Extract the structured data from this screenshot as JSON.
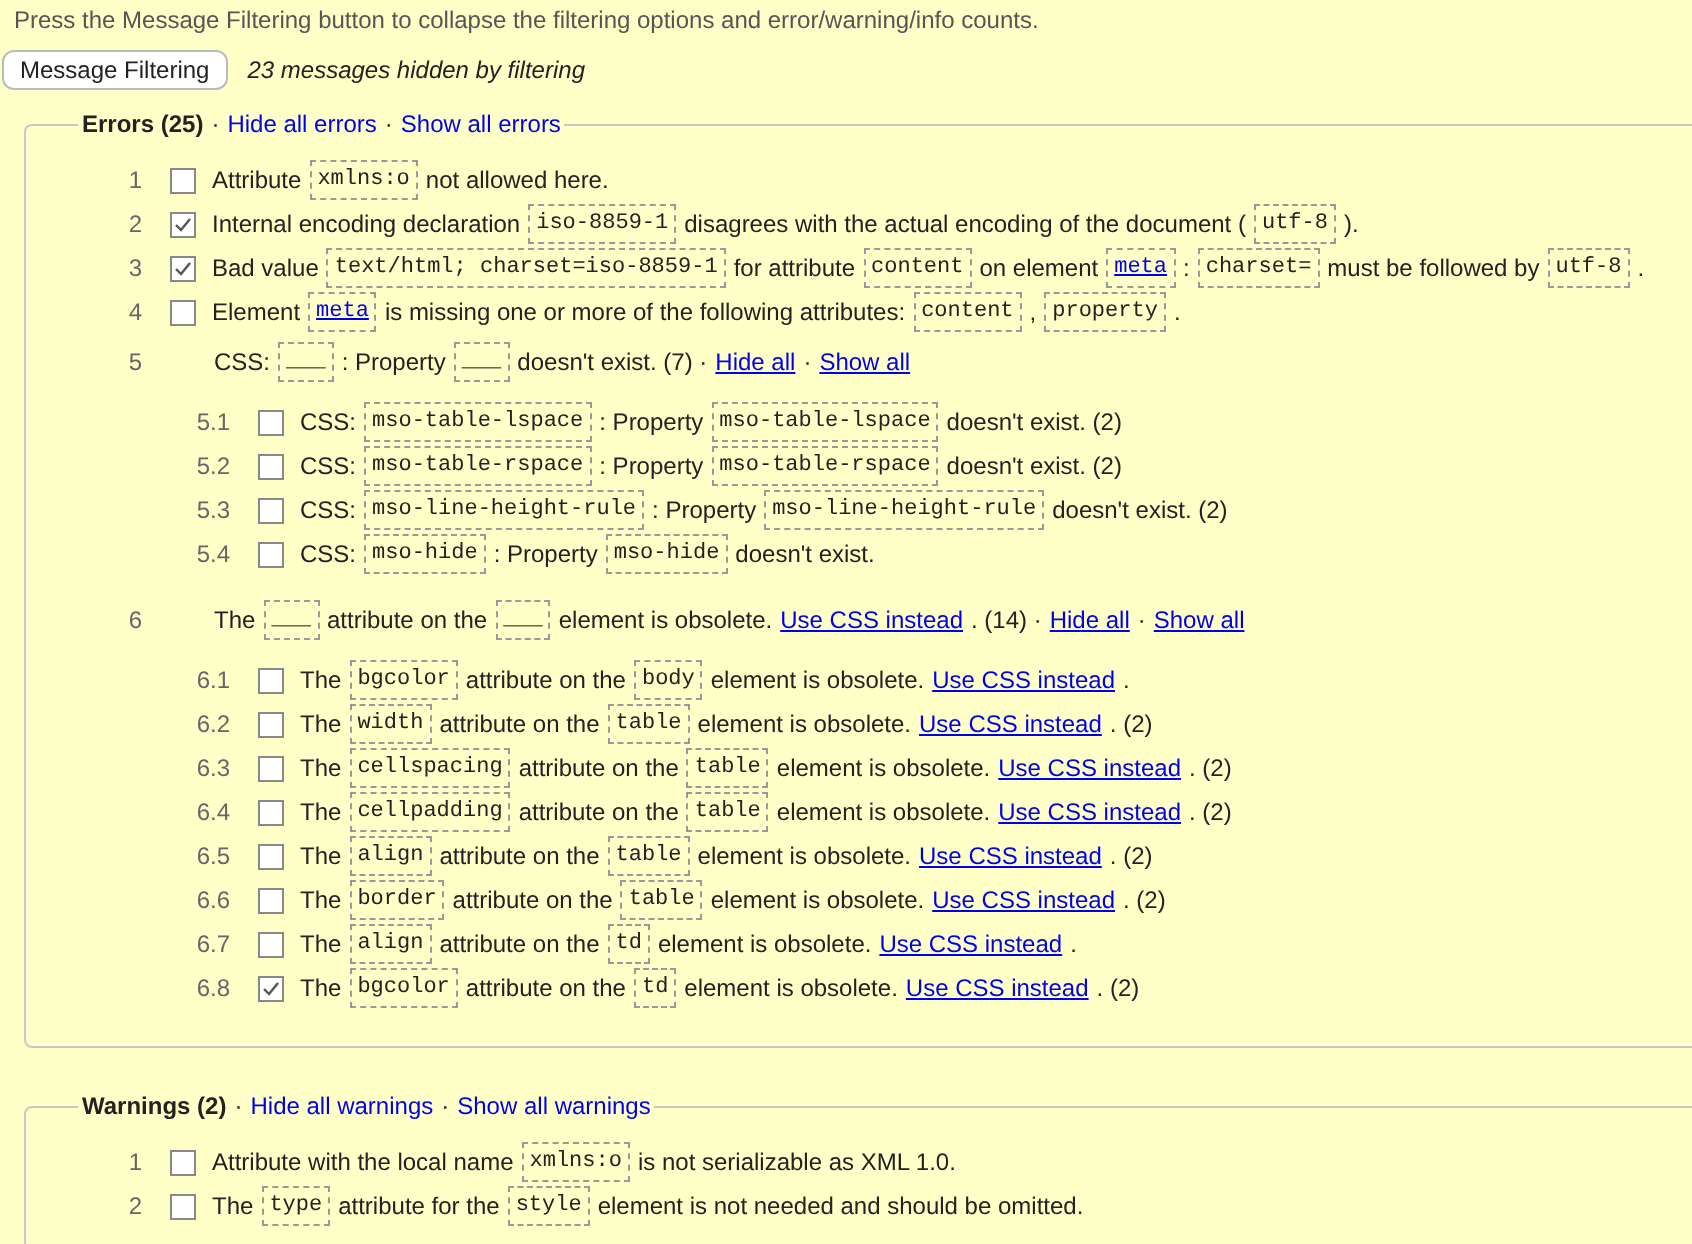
{
  "hint": "Press the Message Filtering button to collapse the filtering options and error/warning/info counts.",
  "filter_button": "Message Filtering",
  "hidden_note": "23 messages hidden by filtering",
  "sections": [
    {
      "legend": [
        {
          "kind": "title",
          "text": "Errors (25)"
        },
        {
          "kind": "text",
          "text": "·"
        },
        {
          "kind": "link",
          "text": "Hide all errors"
        },
        {
          "kind": "text",
          "text": "·"
        },
        {
          "kind": "link",
          "text": "Show all errors"
        }
      ],
      "items": [
        {
          "kind": "message",
          "number": "1",
          "checked": false,
          "parts": [
            {
              "kind": "text",
              "text": "Attribute"
            },
            {
              "kind": "code",
              "text": "xmlns:o"
            },
            {
              "kind": "text",
              "text": "not allowed here."
            }
          ]
        },
        {
          "kind": "message",
          "number": "2",
          "checked": true,
          "parts": [
            {
              "kind": "text",
              "text": "Internal encoding declaration"
            },
            {
              "kind": "code",
              "text": "iso-8859-1"
            },
            {
              "kind": "text",
              "text": "disagrees with the actual encoding of the document ("
            },
            {
              "kind": "code",
              "text": "utf-8"
            },
            {
              "kind": "text",
              "text": ")."
            }
          ]
        },
        {
          "kind": "message",
          "number": "3",
          "checked": true,
          "parts": [
            {
              "kind": "text",
              "text": "Bad value"
            },
            {
              "kind": "code",
              "text": "text/html; charset=iso-8859-1"
            },
            {
              "kind": "text",
              "text": "for attribute"
            },
            {
              "kind": "code",
              "text": "content"
            },
            {
              "kind": "text",
              "text": "on element"
            },
            {
              "kind": "codelink",
              "text": "meta"
            },
            {
              "kind": "text",
              "text": ":"
            },
            {
              "kind": "code",
              "text": "charset="
            },
            {
              "kind": "text",
              "text": "must be followed by"
            },
            {
              "kind": "code",
              "text": "utf-8"
            },
            {
              "kind": "text",
              "text": "."
            }
          ]
        },
        {
          "kind": "message",
          "number": "4",
          "checked": false,
          "parts": [
            {
              "kind": "text",
              "text": "Element"
            },
            {
              "kind": "codelink",
              "text": "meta"
            },
            {
              "kind": "text",
              "text": "is missing one or more of the following attributes:"
            },
            {
              "kind": "code",
              "text": "content"
            },
            {
              "kind": "text",
              "text": ","
            },
            {
              "kind": "code",
              "text": "property"
            },
            {
              "kind": "text",
              "text": "."
            }
          ]
        },
        {
          "kind": "group",
          "number": "5",
          "parts": [
            {
              "kind": "text",
              "text": "CSS:"
            },
            {
              "kind": "code",
              "text": "___"
            },
            {
              "kind": "text",
              "text": ": Property"
            },
            {
              "kind": "code",
              "text": "___"
            },
            {
              "kind": "text",
              "text": "doesn't exist. (7) ·"
            },
            {
              "kind": "link",
              "text": "Hide all"
            },
            {
              "kind": "text",
              "text": "·"
            },
            {
              "kind": "link",
              "text": "Show all"
            }
          ],
          "children": [
            {
              "kind": "message",
              "number": "5.1",
              "checked": false,
              "parts": [
                {
                  "kind": "text",
                  "text": "CSS:"
                },
                {
                  "kind": "code",
                  "text": "mso-table-lspace"
                },
                {
                  "kind": "text",
                  "text": ": Property"
                },
                {
                  "kind": "code",
                  "text": "mso-table-lspace"
                },
                {
                  "kind": "text",
                  "text": "doesn't exist. (2)"
                }
              ]
            },
            {
              "kind": "message",
              "number": "5.2",
              "checked": false,
              "parts": [
                {
                  "kind": "text",
                  "text": "CSS:"
                },
                {
                  "kind": "code",
                  "text": "mso-table-rspace"
                },
                {
                  "kind": "text",
                  "text": ": Property"
                },
                {
                  "kind": "code",
                  "text": "mso-table-rspace"
                },
                {
                  "kind": "text",
                  "text": "doesn't exist. (2)"
                }
              ]
            },
            {
              "kind": "message",
              "number": "5.3",
              "checked": false,
              "parts": [
                {
                  "kind": "text",
                  "text": "CSS:"
                },
                {
                  "kind": "code",
                  "text": "mso-line-height-rule"
                },
                {
                  "kind": "text",
                  "text": ": Property"
                },
                {
                  "kind": "code",
                  "text": "mso-line-height-rule"
                },
                {
                  "kind": "text",
                  "text": "doesn't exist. (2)"
                }
              ]
            },
            {
              "kind": "message",
              "number": "5.4",
              "checked": false,
              "parts": [
                {
                  "kind": "text",
                  "text": "CSS:"
                },
                {
                  "kind": "code",
                  "text": "mso-hide"
                },
                {
                  "kind": "text",
                  "text": ": Property"
                },
                {
                  "kind": "code",
                  "text": "mso-hide"
                },
                {
                  "kind": "text",
                  "text": "doesn't exist."
                }
              ]
            }
          ]
        },
        {
          "kind": "group",
          "number": "6",
          "parts": [
            {
              "kind": "text",
              "text": "The"
            },
            {
              "kind": "code",
              "text": "___"
            },
            {
              "kind": "text",
              "text": "attribute on the"
            },
            {
              "kind": "code",
              "text": "___"
            },
            {
              "kind": "text",
              "text": "element is obsolete."
            },
            {
              "kind": "link",
              "text": "Use CSS instead"
            },
            {
              "kind": "text",
              "text": ". (14) ·"
            },
            {
              "kind": "link",
              "text": "Hide all"
            },
            {
              "kind": "text",
              "text": "·"
            },
            {
              "kind": "link",
              "text": "Show all"
            }
          ],
          "children": [
            {
              "kind": "message",
              "number": "6.1",
              "checked": false,
              "parts": [
                {
                  "kind": "text",
                  "text": "The"
                },
                {
                  "kind": "code",
                  "text": "bgcolor"
                },
                {
                  "kind": "text",
                  "text": "attribute on the"
                },
                {
                  "kind": "code",
                  "text": "body"
                },
                {
                  "kind": "text",
                  "text": "element is obsolete."
                },
                {
                  "kind": "link",
                  "text": "Use CSS instead"
                },
                {
                  "kind": "text",
                  "text": "."
                }
              ]
            },
            {
              "kind": "message",
              "number": "6.2",
              "checked": false,
              "parts": [
                {
                  "kind": "text",
                  "text": "The"
                },
                {
                  "kind": "code",
                  "text": "width"
                },
                {
                  "kind": "text",
                  "text": "attribute on the"
                },
                {
                  "kind": "code",
                  "text": "table"
                },
                {
                  "kind": "text",
                  "text": "element is obsolete."
                },
                {
                  "kind": "link",
                  "text": "Use CSS instead"
                },
                {
                  "kind": "text",
                  "text": ". (2)"
                }
              ]
            },
            {
              "kind": "message",
              "number": "6.3",
              "checked": false,
              "parts": [
                {
                  "kind": "text",
                  "text": "The"
                },
                {
                  "kind": "code",
                  "text": "cellspacing"
                },
                {
                  "kind": "text",
                  "text": "attribute on the"
                },
                {
                  "kind": "code",
                  "text": "table"
                },
                {
                  "kind": "text",
                  "text": "element is obsolete."
                },
                {
                  "kind": "link",
                  "text": "Use CSS instead"
                },
                {
                  "kind": "text",
                  "text": ". (2)"
                }
              ]
            },
            {
              "kind": "message",
              "number": "6.4",
              "checked": false,
              "parts": [
                {
                  "kind": "text",
                  "text": "The"
                },
                {
                  "kind": "code",
                  "text": "cellpadding"
                },
                {
                  "kind": "text",
                  "text": "attribute on the"
                },
                {
                  "kind": "code",
                  "text": "table"
                },
                {
                  "kind": "text",
                  "text": "element is obsolete."
                },
                {
                  "kind": "link",
                  "text": "Use CSS instead"
                },
                {
                  "kind": "text",
                  "text": ". (2)"
                }
              ]
            },
            {
              "kind": "message",
              "number": "6.5",
              "checked": false,
              "parts": [
                {
                  "kind": "text",
                  "text": "The"
                },
                {
                  "kind": "code",
                  "text": "align"
                },
                {
                  "kind": "text",
                  "text": "attribute on the"
                },
                {
                  "kind": "code",
                  "text": "table"
                },
                {
                  "kind": "text",
                  "text": "element is obsolete."
                },
                {
                  "kind": "link",
                  "text": "Use CSS instead"
                },
                {
                  "kind": "text",
                  "text": ". (2)"
                }
              ]
            },
            {
              "kind": "message",
              "number": "6.6",
              "checked": false,
              "parts": [
                {
                  "kind": "text",
                  "text": "The"
                },
                {
                  "kind": "code",
                  "text": "border"
                },
                {
                  "kind": "text",
                  "text": "attribute on the"
                },
                {
                  "kind": "code",
                  "text": "table"
                },
                {
                  "kind": "text",
                  "text": "element is obsolete."
                },
                {
                  "kind": "link",
                  "text": "Use CSS instead"
                },
                {
                  "kind": "text",
                  "text": ". (2)"
                }
              ]
            },
            {
              "kind": "message",
              "number": "6.7",
              "checked": false,
              "parts": [
                {
                  "kind": "text",
                  "text": "The"
                },
                {
                  "kind": "code",
                  "text": "align"
                },
                {
                  "kind": "text",
                  "text": "attribute on the"
                },
                {
                  "kind": "code",
                  "text": "td"
                },
                {
                  "kind": "text",
                  "text": "element is obsolete."
                },
                {
                  "kind": "link",
                  "text": "Use CSS instead"
                },
                {
                  "kind": "text",
                  "text": "."
                }
              ]
            },
            {
              "kind": "message",
              "number": "6.8",
              "checked": true,
              "parts": [
                {
                  "kind": "text",
                  "text": "The"
                },
                {
                  "kind": "code",
                  "text": "bgcolor"
                },
                {
                  "kind": "text",
                  "text": "attribute on the"
                },
                {
                  "kind": "code",
                  "text": "td"
                },
                {
                  "kind": "text",
                  "text": "element is obsolete."
                },
                {
                  "kind": "link",
                  "text": "Use CSS instead"
                },
                {
                  "kind": "text",
                  "text": ". (2)"
                }
              ]
            }
          ]
        }
      ]
    },
    {
      "legend": [
        {
          "kind": "title",
          "text": "Warnings (2)"
        },
        {
          "kind": "text",
          "text": "·"
        },
        {
          "kind": "link",
          "text": "Hide all warnings"
        },
        {
          "kind": "text",
          "text": "·"
        },
        {
          "kind": "link",
          "text": "Show all warnings"
        }
      ],
      "items": [
        {
          "kind": "message",
          "number": "1",
          "checked": false,
          "parts": [
            {
              "kind": "text",
              "text": "Attribute with the local name"
            },
            {
              "kind": "code",
              "text": "xmlns:o"
            },
            {
              "kind": "text",
              "text": "is not serializable as XML 1.0."
            }
          ]
        },
        {
          "kind": "message",
          "number": "2",
          "checked": false,
          "parts": [
            {
              "kind": "text",
              "text": "The"
            },
            {
              "kind": "code",
              "text": "type"
            },
            {
              "kind": "text",
              "text": "attribute for the"
            },
            {
              "kind": "code",
              "text": "style"
            },
            {
              "kind": "text",
              "text": "element is not needed and should be omitted."
            }
          ]
        }
      ]
    }
  ]
}
